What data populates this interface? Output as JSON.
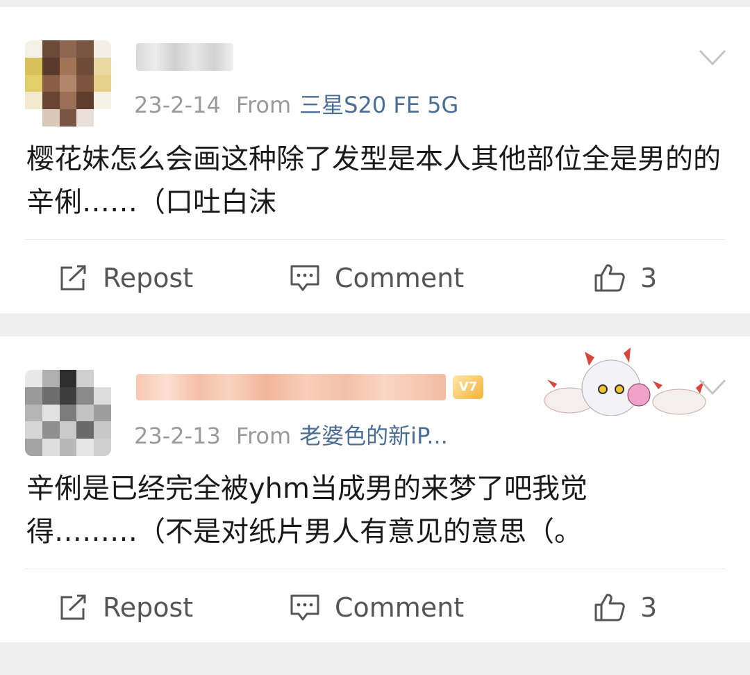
{
  "posts": [
    {
      "date": "23-2-14",
      "from_label": "From",
      "device": "三星S20 FE 5G",
      "text": "樱花妹怎么会画这种除了发型是本人其他部位全是男的的辛俐……（口吐白沫",
      "actions": {
        "repost": "Repost",
        "comment": "Comment",
        "likes": "3"
      }
    },
    {
      "date": "23-2-13",
      "from_label": "From",
      "device": "老婆色的新iP...",
      "text": "辛俐是已经完全被yhm当成男的来梦了吧我觉得………（不是对纸片男人有意见的意思（。",
      "badge": "V7",
      "actions": {
        "repost": "Repost",
        "comment": "Comment",
        "likes": "3"
      }
    }
  ],
  "icons": {
    "repost": "repost-icon",
    "comment": "comment-icon",
    "like": "thumbs-up-icon",
    "menu": "chevron-down-icon"
  },
  "colors": {
    "device_link": "#4a6d96",
    "meta_text": "#9a9a9a",
    "action_text": "#555555",
    "page_bg": "#eeeeee"
  }
}
